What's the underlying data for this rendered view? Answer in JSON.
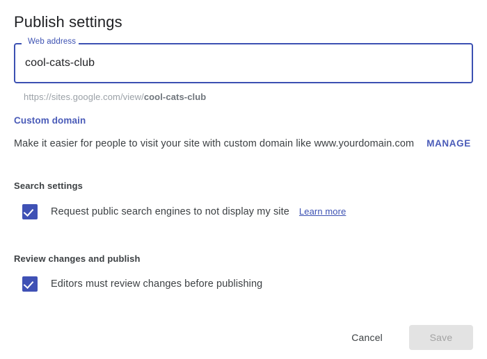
{
  "dialog": {
    "title": "Publish settings"
  },
  "web_address": {
    "label": "Web address",
    "value": "cool-cats-club",
    "placeholder": "Web address",
    "preview_prefix": "https://sites.google.com/view/",
    "preview_slug": "cool-cats-club"
  },
  "custom_domain": {
    "heading": "Custom domain",
    "description": "Make it easier for people to visit your site with custom domain like www.yourdomain.com",
    "manage_label": "MANAGE"
  },
  "search_settings": {
    "heading": "Search settings",
    "checkbox_label": "Request public search engines to not display my site",
    "checkbox_checked": true,
    "learn_more_label": "Learn more"
  },
  "review_settings": {
    "heading": "Review changes and publish",
    "checkbox_label": "Editors must review changes before publishing",
    "checkbox_checked": true
  },
  "actions": {
    "cancel_label": "Cancel",
    "save_label": "Save",
    "save_disabled": true
  },
  "colors": {
    "accent_blue": "#3b50b2",
    "link_blue": "#4a5bb8",
    "checkbox_fill": "#3f51b5",
    "text_primary": "#3c4043",
    "text_muted": "#9aa0a6",
    "disabled_button_bg": "#e3e3e3",
    "disabled_button_text": "#a3a3a3"
  }
}
